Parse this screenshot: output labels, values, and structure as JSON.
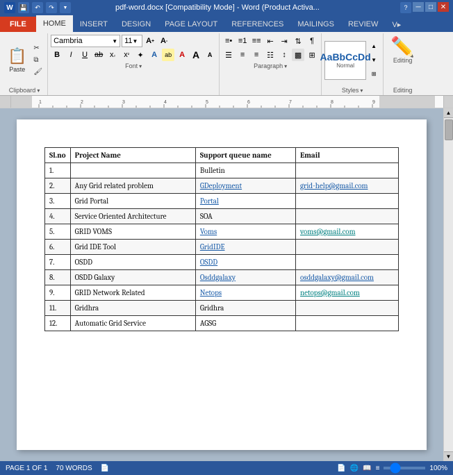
{
  "titlebar": {
    "title": "pdf-word.docx [Compatibility Mode] - Word (Product Activa...",
    "controls": [
      "─",
      "□",
      "✕"
    ]
  },
  "ribbon": {
    "tabs": [
      "FILE",
      "HOME",
      "INSERT",
      "DESIGN",
      "PAGE LAYOUT",
      "REFERENCES",
      "MAILINGS",
      "REVIEW",
      "V"
    ],
    "active_tab": "HOME",
    "clipboard_group": "Clipboard",
    "font_group": "Font",
    "paragraph_group": "Paragraph",
    "styles_group": "Styles",
    "editing_group": "Editing",
    "font_name": "Cambria",
    "font_size": "11",
    "editing_label": "Editing"
  },
  "toolbar": {
    "paste_label": "Paste",
    "save_label": "Save"
  },
  "table": {
    "headers": [
      "Sl.no",
      "Project Name",
      "Support queue name",
      "Email"
    ],
    "rows": [
      {
        "num": "1.",
        "project": "",
        "queue": "Bulletin",
        "email": ""
      },
      {
        "num": "2.",
        "project": "Any Grid related problem",
        "queue": "GDeployment",
        "email": "grid-help@gmail.com",
        "queue_link": true,
        "email_link": false
      },
      {
        "num": "3.",
        "project": "Grid Portal",
        "queue": "Portal",
        "email": "",
        "queue_link": true
      },
      {
        "num": "4.",
        "project": "Service Oriented Architecture",
        "queue": "SOA",
        "email": ""
      },
      {
        "num": "5.",
        "project": "GRID VOMS",
        "queue": "Voms",
        "email": "voms@gmail.com",
        "queue_link": true,
        "email_teal": true
      },
      {
        "num": "6.",
        "project": "Grid IDE Tool",
        "queue": "GridIDE",
        "email": "",
        "queue_link": true
      },
      {
        "num": "7.",
        "project": "OSDD",
        "queue": "OSDD",
        "email": "",
        "queue_link": true
      },
      {
        "num": "8.",
        "project": "OSDD Galaxy",
        "queue": "Osddgalaxy",
        "email": "osddgalaxy@gmail.com",
        "queue_link": true
      },
      {
        "num": "9.",
        "project": "GRID Network Related",
        "queue": "Netops",
        "email": "netops@gmail.com",
        "queue_link": true,
        "email_teal": true
      },
      {
        "num": "11.",
        "project": "Gridhra",
        "queue": "Gridhra",
        "email": ""
      },
      {
        "num": "12.",
        "project": "Automatic Grid Service",
        "queue": "AGSG",
        "email": ""
      }
    ]
  },
  "statusbar": {
    "page": "PAGE 1 OF 1",
    "words": "70 WORDS",
    "zoom": "100%"
  }
}
